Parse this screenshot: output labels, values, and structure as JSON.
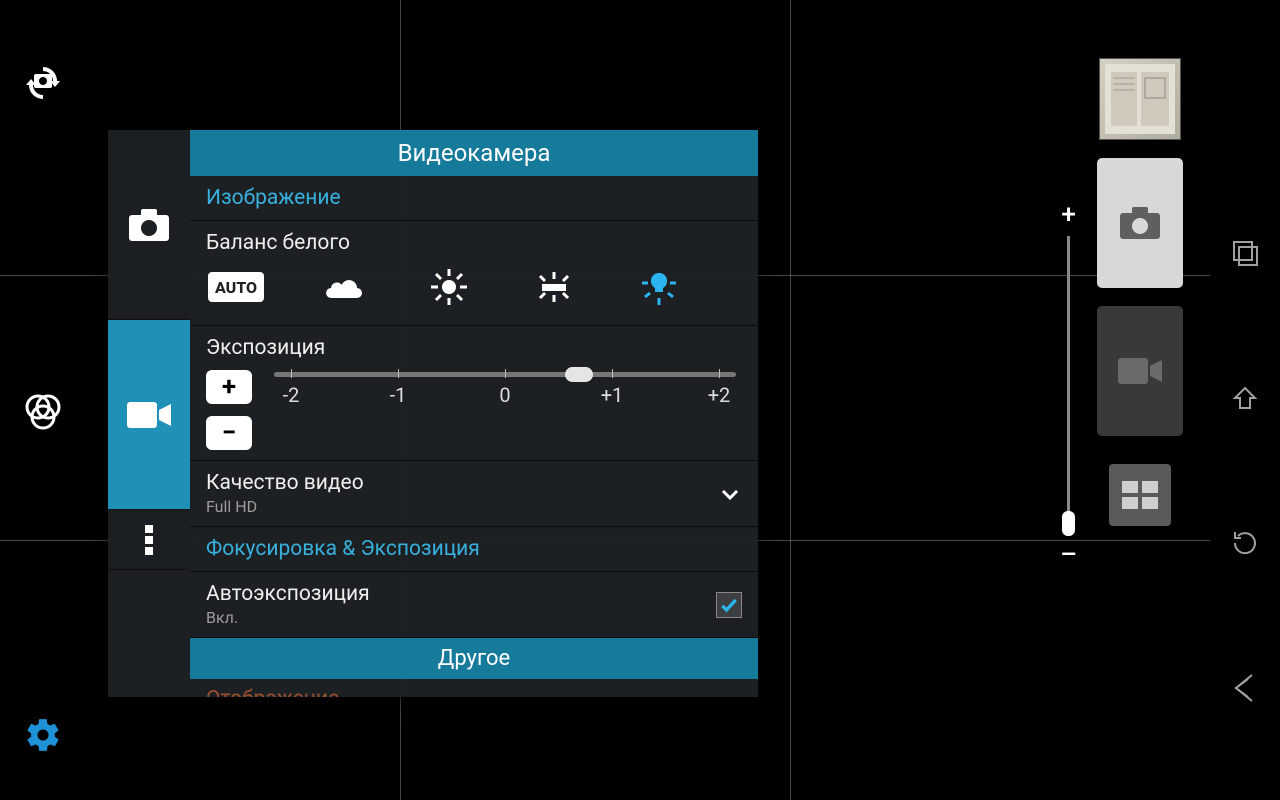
{
  "left_rail": {
    "switch_camera": "switch-camera",
    "effects": "color-effects",
    "gear": "settings"
  },
  "zoom": {
    "plus": "+",
    "minus": "–"
  },
  "menu": {
    "title": "Видеокамера",
    "sections": {
      "image": "Изображение",
      "focus_exposure": "Фокусировка & Экспозиция"
    },
    "white_balance": {
      "label": "Баланс белого",
      "options": {
        "auto": "AUTO"
      }
    },
    "exposure": {
      "label": "Экспозиция",
      "ticks": [
        "-2",
        "-1",
        "0",
        "+1",
        "+2"
      ],
      "value_position_pct": 63
    },
    "video_quality": {
      "label": "Качество видео",
      "value": "Full HD"
    },
    "auto_exposure": {
      "label": "Автоэкспозиция",
      "value": "Вкл.",
      "checked": true
    },
    "other": "Другое",
    "cutoff": "Отображение"
  },
  "modes": {
    "photo": "photo-mode",
    "video": "video-mode",
    "grid": "gallery-grid"
  }
}
